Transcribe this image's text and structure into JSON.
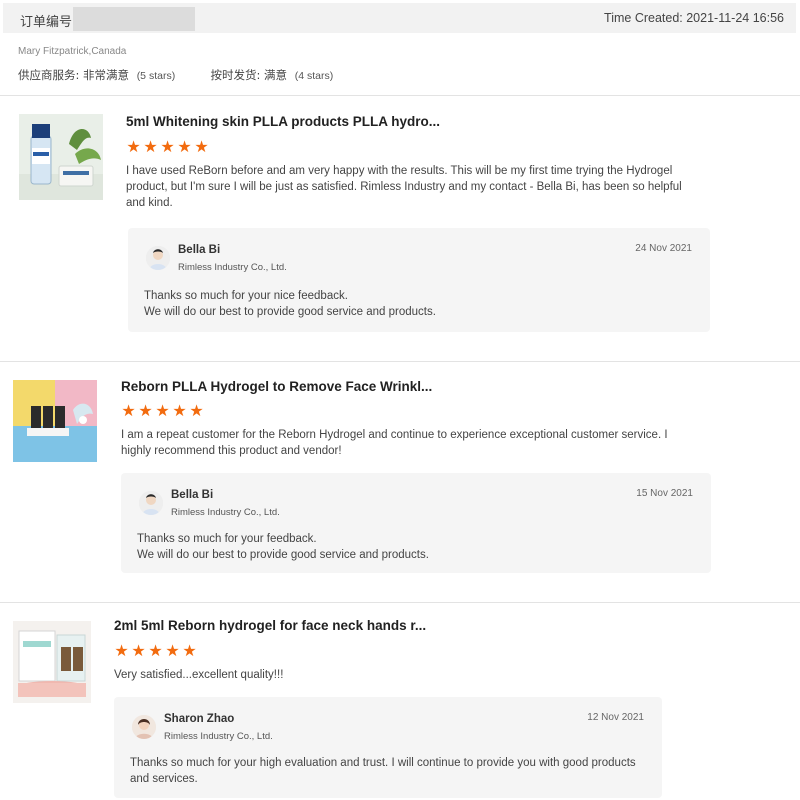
{
  "header": {
    "order_label": "订单编号:",
    "time_created": "Time Created: 2021-11-24 16:56"
  },
  "buyer": {
    "name": "Mary Fitzpatrick,Canada",
    "supplier_service_label": "供应商服务:",
    "supplier_service_value": "非常满意",
    "supplier_service_stars": "(5 stars)",
    "ontime_label": "按时发货:",
    "ontime_value": "满意",
    "ontime_stars": "(4 stars)"
  },
  "reviews": [
    {
      "title": "5ml Whitening skin PLLA products PLLA hydro...",
      "rating": 5,
      "text": "I have used ReBorn before and am very happy with the results.  This will be my first time trying the Hydrogel product, but I'm sure I will be just as satisfied.  Rimless Industry and my contact - Bella Bi, has been so helpful and kind.",
      "reply": {
        "name": "Bella Bi",
        "company": "Rimless Industry Co., Ltd.",
        "date": "24 Nov 2021",
        "line1": "Thanks so much for your nice feedback.",
        "line2": "We will do our best to provide good service and products."
      }
    },
    {
      "title": "Reborn PLLA Hydrogel to Remove Face Wrinkl...",
      "rating": 5,
      "text": "I am a repeat customer for the Reborn Hydrogel and continue to experience exceptional customer service. I highly recommend this product and vendor!",
      "reply": {
        "name": "Bella Bi",
        "company": "Rimless Industry Co., Ltd.",
        "date": "15 Nov 2021",
        "line1": "Thanks so much for your feedback.",
        "line2": "We will do our best to provide good service and products."
      }
    },
    {
      "title": "2ml 5ml Reborn hydrogel for face neck hands r...",
      "rating": 5,
      "text": "Very satisfied...excellent quality!!!",
      "reply": {
        "name": "Sharon Zhao",
        "company": "Rimless Industry Co., Ltd.",
        "date": "12 Nov 2021",
        "line1": "Thanks so much for your high evaluation and trust. I will continue to provide you with good products and services.",
        "line2": ""
      }
    }
  ],
  "colors": {
    "star": "#f26b0f",
    "reply_bg": "#f5f5f5",
    "header_bg": "#f2f2f2"
  },
  "icons": {
    "rating": "star-icon",
    "avatar": "avatar-icon"
  }
}
